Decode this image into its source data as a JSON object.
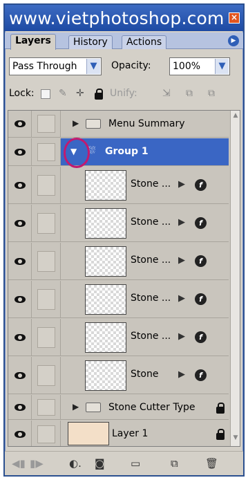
{
  "title": "www.vietphotoshop.com",
  "tabs": [
    "Layers",
    "History",
    "Actions"
  ],
  "blend_mode": "Pass Through",
  "opacity_label": "Opacity:",
  "opacity_value": "100%",
  "lock_label": "Lock:",
  "unify_label": "Unify:",
  "layers": [
    {
      "name": "Menu Summary",
      "type": "group-collapsed"
    },
    {
      "name": "Group 1",
      "type": "group-expanded",
      "selected": true
    },
    {
      "name": "Stone ...",
      "type": "layer-fx"
    },
    {
      "name": "Stone ...",
      "type": "layer-fx"
    },
    {
      "name": "Stone ...",
      "type": "layer-fx"
    },
    {
      "name": "Stone ...",
      "type": "layer-fx"
    },
    {
      "name": "Stone ...",
      "type": "layer-fx"
    },
    {
      "name": "Stone",
      "type": "layer-fx"
    },
    {
      "name": "Stone Cutter Type",
      "type": "group-collapsed-locked"
    },
    {
      "name": "Layer 1",
      "type": "layer-locked"
    }
  ],
  "colors": {
    "titlebar": "#1d4aa3",
    "selection": "#3a66c4",
    "annotation_circle": "#c21a6f",
    "panel_bg": "#d4d0c8"
  },
  "icons": [
    "close-icon",
    "panel-menu-icon",
    "eye-icon",
    "folder-icon",
    "fx-icon",
    "lock-icon",
    "trash-icon",
    "new-layer-icon",
    "new-group-icon",
    "mask-icon",
    "link-icon"
  ]
}
